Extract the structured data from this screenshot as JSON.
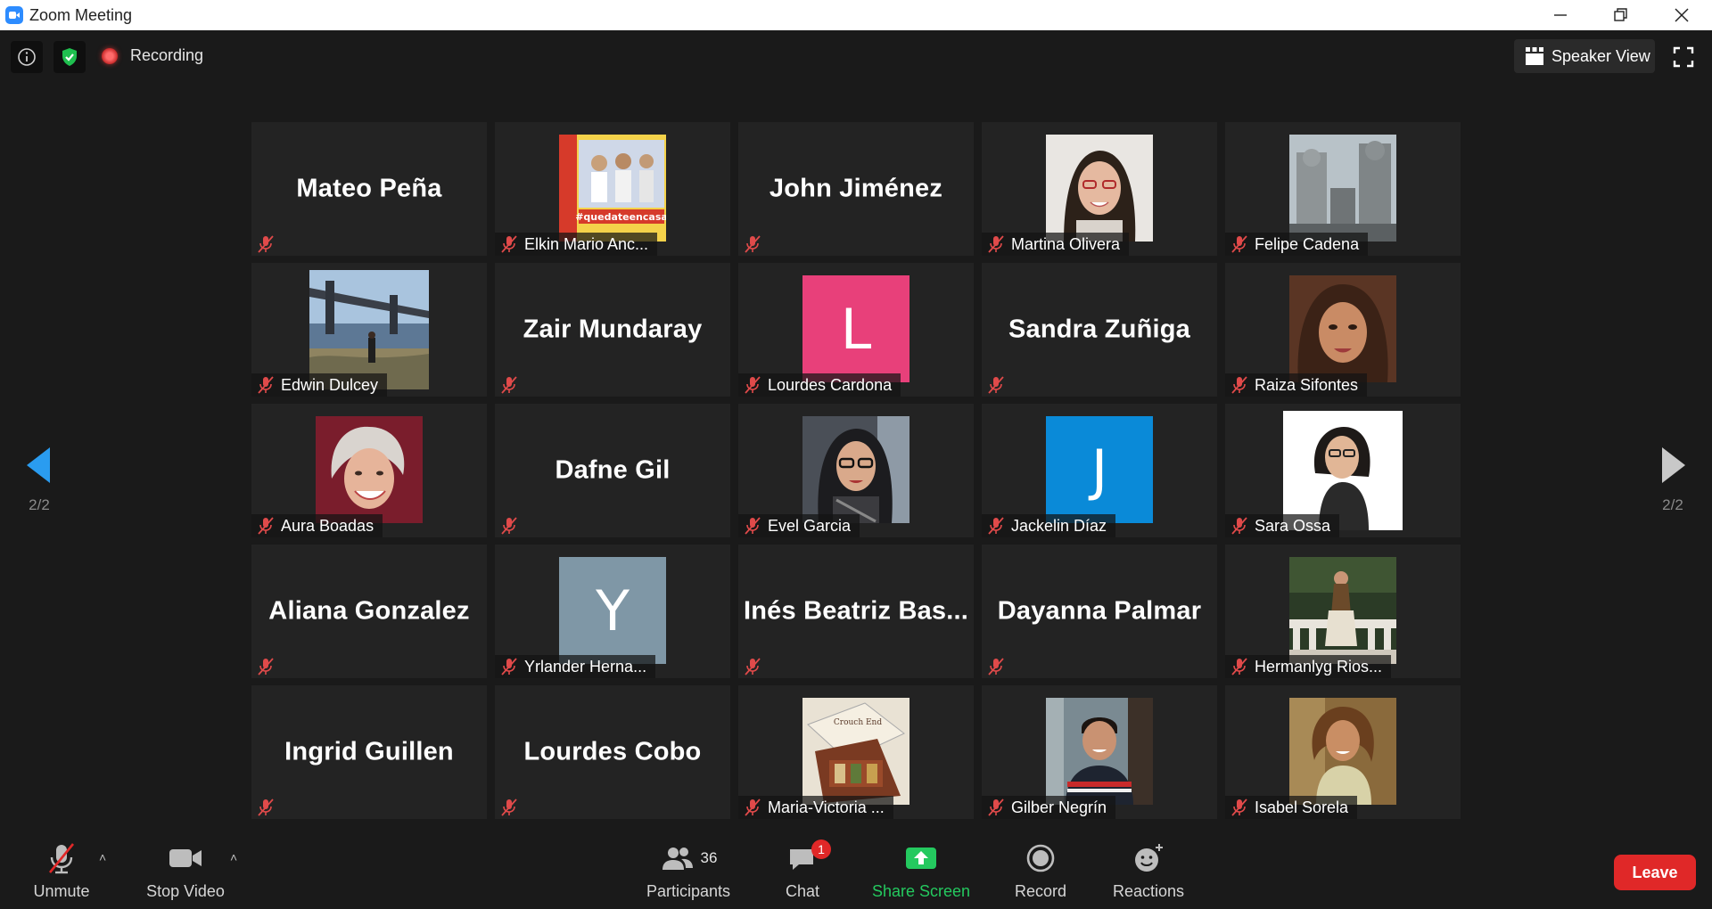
{
  "window": {
    "title": "Zoom Meeting"
  },
  "topbar": {
    "recording_label": "Recording",
    "speaker_view_label": "Speaker View"
  },
  "nav": {
    "left_page": "2/2",
    "right_page": "2/2"
  },
  "participants": [
    {
      "name": "Mateo Peña",
      "display": "name"
    },
    {
      "name": "Elkin Mario Anc...",
      "display": "photo",
      "photo": "poster"
    },
    {
      "name": "John Jiménez",
      "display": "name"
    },
    {
      "name": "Martina Olivera",
      "display": "photo",
      "photo": "portrait-woman"
    },
    {
      "name": "Felipe Cadena",
      "display": "photo",
      "photo": "statues"
    },
    {
      "name": "Edwin Dulcey",
      "display": "photo",
      "photo": "bridge"
    },
    {
      "name": "Zair Mundaray",
      "display": "name"
    },
    {
      "name": "Lourdes Cardona",
      "display": "avatar",
      "letter": "L",
      "color": "#e8407a"
    },
    {
      "name": "Sandra Zuñiga",
      "display": "name"
    },
    {
      "name": "Raiza Sifontes",
      "display": "photo",
      "photo": "portrait-tan"
    },
    {
      "name": "Aura Boadas",
      "display": "photo",
      "photo": "portrait-smile"
    },
    {
      "name": "Dafne Gil",
      "display": "name"
    },
    {
      "name": "Evel Garcia",
      "display": "photo",
      "photo": "portrait-glasses"
    },
    {
      "name": "Jackelin Díaz",
      "display": "avatar",
      "letter": "J",
      "color": "#0a8ad8"
    },
    {
      "name": "Sara Ossa",
      "display": "photo",
      "photo": "portrait-white"
    },
    {
      "name": "Aliana Gonzalez",
      "display": "name"
    },
    {
      "name": "Yrlander Herna...",
      "display": "avatar",
      "letter": "Y",
      "color": "#7f97a6"
    },
    {
      "name": "Inés  Beatriz  Bas...",
      "display": "name"
    },
    {
      "name": "Dayanna Palmar",
      "display": "name"
    },
    {
      "name": "Hermanlyg Rios...",
      "display": "photo",
      "photo": "balcony"
    },
    {
      "name": "Ingrid Guillen",
      "display": "name"
    },
    {
      "name": "Lourdes Cobo",
      "display": "name"
    },
    {
      "name": "Maria-Victoria ...",
      "display": "photo",
      "photo": "book"
    },
    {
      "name": "Gilber Negrín",
      "display": "photo",
      "photo": "portrait-man"
    },
    {
      "name": "Isabel Sorela",
      "display": "photo",
      "photo": "portrait-curly"
    }
  ],
  "toolbar": {
    "unmute_label": "Unmute",
    "stop_video_label": "Stop Video",
    "participants_label": "Participants",
    "participants_count": "36",
    "chat_label": "Chat",
    "chat_badge": "1",
    "share_screen_label": "Share Screen",
    "record_label": "Record",
    "reactions_label": "Reactions",
    "leave_label": "Leave"
  },
  "colors": {
    "accent_blue": "#2d8cff",
    "share_green": "#24c95f",
    "leave_red": "#e02828",
    "tile_bg": "#232323"
  }
}
